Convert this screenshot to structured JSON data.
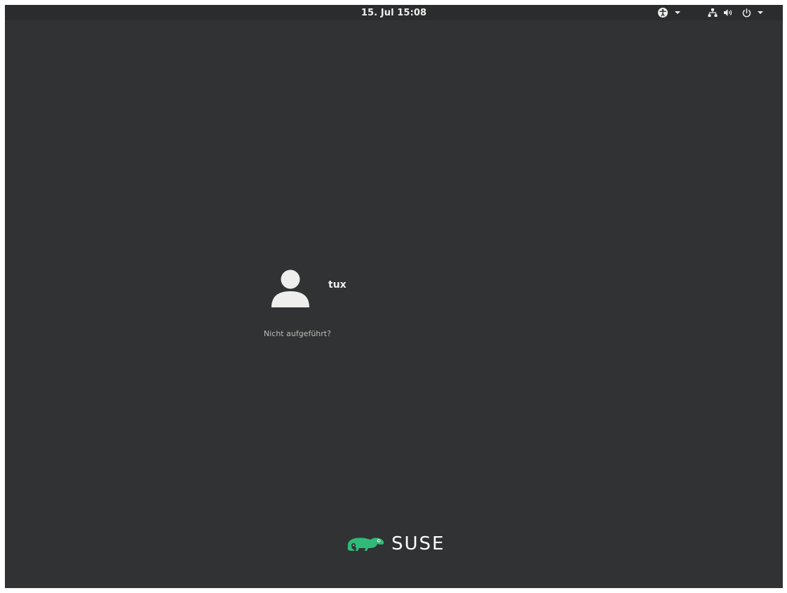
{
  "topbar": {
    "clock": "15. Jul 15:08",
    "icons": {
      "accessibility": "accessibility-icon",
      "accessibility_menu": "chevron-down-icon",
      "network": "network-wired-icon",
      "volume": "volume-icon",
      "power": "power-icon",
      "system_menu": "chevron-down-icon"
    }
  },
  "user_list": {
    "users": [
      {
        "name": "tux",
        "avatar": "user-avatar-icon"
      }
    ],
    "not_listed_label": "Nicht aufgeführt?"
  },
  "branding": {
    "logo_text": "SUSE",
    "logo_icon": "chameleon-icon",
    "logo_color": "#30ba78"
  },
  "colors": {
    "background": "#303234",
    "topbar": "#2a2c2e",
    "text": "#eeeeec",
    "muted_text": "#babdb6"
  }
}
